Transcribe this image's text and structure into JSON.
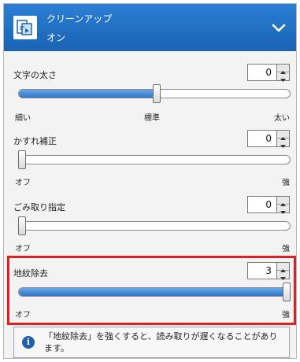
{
  "header": {
    "title": "クリーンアップ",
    "status": "オン",
    "icon": "cleanup-icon",
    "toggle_icon": "chevron-down-icon"
  },
  "settings": [
    {
      "label": "文字の太さ",
      "value": "0",
      "level_percent": 51,
      "scale": {
        "left": "細い",
        "center": "標準",
        "right": "太い"
      }
    },
    {
      "label": "かすれ補正",
      "value": "0",
      "level_percent": 0,
      "scale": {
        "left": "オフ",
        "right": "強"
      }
    },
    {
      "label": "ごみ取り指定",
      "value": "0",
      "level_percent": 0,
      "scale": {
        "left": "オフ",
        "right": "強"
      }
    },
    {
      "label": "地紋除去",
      "value": "3",
      "level_percent": 100,
      "highlighted": true,
      "scale": {
        "left": "オフ",
        "right": "強"
      }
    }
  ],
  "info": {
    "icon": "info-icon",
    "text": "「地紋除去」を強くすると、読み取りが遅くなることがあります。"
  },
  "colors": {
    "header_bg": "#1f6dc0",
    "slider_fill": "#3b7fcf",
    "highlight_border": "#e02020"
  }
}
